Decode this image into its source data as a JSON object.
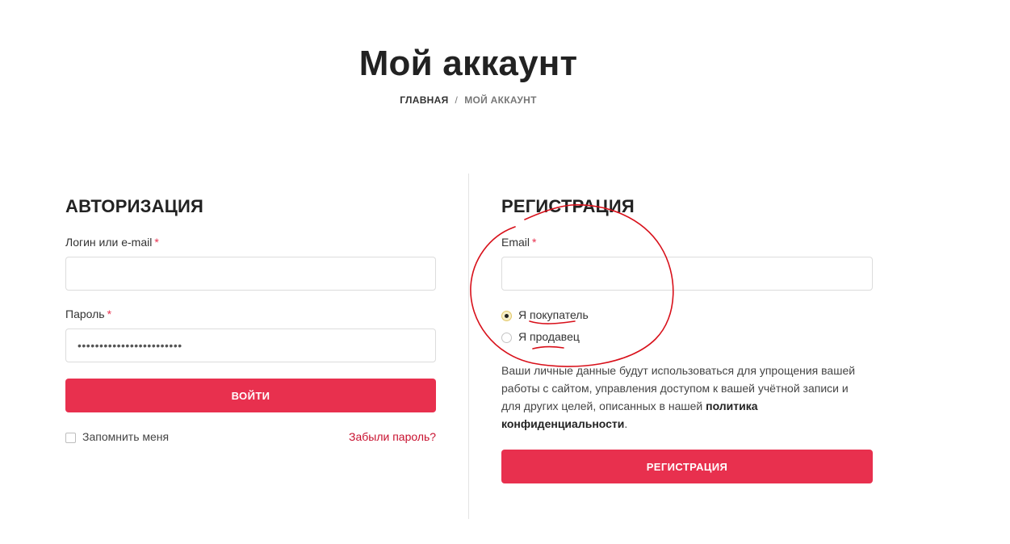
{
  "header": {
    "title": "Мой аккаунт",
    "breadcrumb": {
      "home": "Главная",
      "separator": "/",
      "current": "Мой аккаунт"
    }
  },
  "login": {
    "title": "АВТОРИЗАЦИЯ",
    "username_label": "Логин или e-mail",
    "username_value": "",
    "password_label": "Пароль",
    "password_value": "••••••••••••••••••••••••",
    "required_mark": "*",
    "submit_label": "ВОЙТИ",
    "remember_label": "Запомнить меня",
    "remember_checked": false,
    "forgot_label": "Забыли пароль?"
  },
  "register": {
    "title": "РЕГИСТРАЦИЯ",
    "email_label": "Email",
    "email_value": "",
    "required_mark": "*",
    "role_options": [
      {
        "label": "Я покупатель",
        "checked": true
      },
      {
        "label": "Я продавец",
        "checked": false
      }
    ],
    "privacy_text": "Ваши личные данные будут использоваться для упрощения вашей работы с сайтом, управления доступом к вашей учётной записи и для других целей, описанных в нашей",
    "privacy_link": "политика конфиденциальности",
    "privacy_end": ".",
    "submit_label": "РЕГИСТРАЦИЯ"
  },
  "colors": {
    "accent": "#e8304e",
    "link": "#c8102e",
    "annotation": "#d8101a"
  }
}
